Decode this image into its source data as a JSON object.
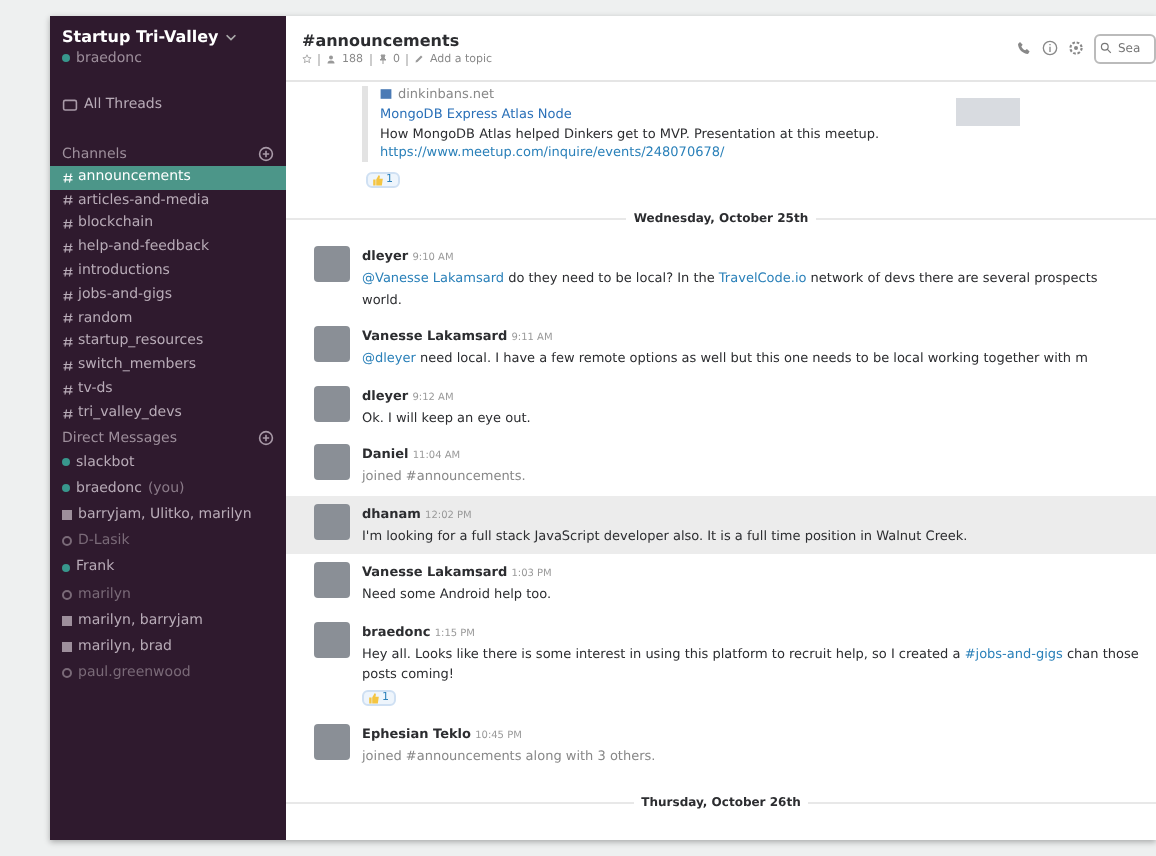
{
  "sidebar": {
    "team": "Startup Tri-Valley",
    "user": "braedonc",
    "all_threads": "All Threads",
    "channels_title": "Channels",
    "channels": [
      {
        "name": "announcements",
        "selected": true
      },
      {
        "name": "articles-and-media",
        "selected": false
      },
      {
        "name": "blockchain",
        "selected": false
      },
      {
        "name": "help-and-feedback",
        "selected": false
      },
      {
        "name": "introductions",
        "selected": false
      },
      {
        "name": "jobs-and-gigs",
        "selected": false
      },
      {
        "name": "random",
        "selected": false
      },
      {
        "name": "startup_resources",
        "selected": false
      },
      {
        "name": "switch_members",
        "selected": false
      },
      {
        "name": "tv-ds",
        "selected": false
      },
      {
        "name": "tri_valley_devs",
        "selected": false
      }
    ],
    "dm_title": "Direct Messages",
    "direct_messages": [
      {
        "kind": "person",
        "name": "slackbot",
        "online": true
      },
      {
        "kind": "person",
        "name": "braedonc",
        "suffix": "(you)",
        "online": true
      },
      {
        "kind": "group",
        "name": "barryjam, Ulitko, marilyn"
      },
      {
        "kind": "person",
        "name": "D-Lasik",
        "online": false
      },
      {
        "kind": "person",
        "name": "Frank",
        "online": true
      },
      {
        "kind": "person",
        "name": "marilyn",
        "online": false
      },
      {
        "kind": "group",
        "name": "marilyn, barryjam"
      },
      {
        "kind": "group",
        "name": "marilyn, brad"
      },
      {
        "kind": "person",
        "name": "paul.greenwood",
        "online": false
      }
    ]
  },
  "header": {
    "channel": "#announcements",
    "members": "188",
    "pins": "0",
    "topic": "Add a topic",
    "search": {
      "placeholder": "Sea"
    }
  },
  "attachment": {
    "site": "dinkinbans.net",
    "title": "MongoDB Express Atlas Node",
    "text": "How MongoDB Atlas helped Dinkers get to MVP. Presentation at this meetup.",
    "url": "https://www.meetup.com/inquire/events/248070678/",
    "reaction": "1"
  },
  "feed": [
    {
      "kind": "divider",
      "label": "Wednesday, October 25th"
    },
    {
      "kind": "message",
      "author": "dleyer",
      "time": "9:10 AM",
      "highlighted": false,
      "segments": [
        {
          "kind": "mention",
          "text": "@Vanesse Lakamsard"
        },
        {
          "kind": "text",
          "text": " do they need to be local? In the "
        },
        {
          "kind": "link",
          "text": "TravelCode.io"
        },
        {
          "kind": "text",
          "text": " network of devs there are several prospects world."
        }
      ]
    },
    {
      "kind": "message",
      "author": "Vanesse Lakamsard",
      "time": "9:11 AM",
      "highlighted": false,
      "segments": [
        {
          "kind": "mention",
          "text": "@dleyer"
        },
        {
          "kind": "text",
          "text": " need local. I have a few remote options as well but this one needs to be local working together with m"
        }
      ]
    },
    {
      "kind": "message",
      "author": "dleyer",
      "time": "9:12 AM",
      "highlighted": false,
      "segments": [
        {
          "kind": "text",
          "text": "Ok. I will keep an eye out."
        }
      ]
    },
    {
      "kind": "message",
      "author": "Daniel",
      "time": "11:04 AM",
      "highlighted": false,
      "segments": [
        {
          "kind": "system",
          "text": "joined #announcements."
        }
      ]
    },
    {
      "kind": "message",
      "author": "dhanam",
      "time": "12:02 PM",
      "highlighted": true,
      "segments": [
        {
          "kind": "text",
          "text": "I'm looking for a full stack JavaScript developer also. It is a full time position in Walnut Creek."
        }
      ]
    },
    {
      "kind": "message",
      "author": "Vanesse Lakamsard",
      "time": "1:03 PM",
      "highlighted": false,
      "segments": [
        {
          "kind": "text",
          "text": "Need some Android help too."
        }
      ]
    },
    {
      "kind": "message",
      "author": "braedonc",
      "time": "1:15 PM",
      "highlighted": false,
      "reaction": "1",
      "segments": [
        {
          "kind": "text",
          "text": "Hey all. Looks like there is some interest in using this platform to recruit help, so I created a "
        },
        {
          "kind": "link",
          "text": "#jobs-and-gigs"
        },
        {
          "kind": "text",
          "text": " chan those posts coming!"
        }
      ]
    },
    {
      "kind": "message",
      "author": "Ephesian Teklo",
      "time": "10:45 PM",
      "highlighted": false,
      "segments": [
        {
          "kind": "system",
          "text": "joined #announcements along with 3 others."
        }
      ]
    },
    {
      "kind": "divider",
      "label": "Thursday, October 26th"
    }
  ]
}
